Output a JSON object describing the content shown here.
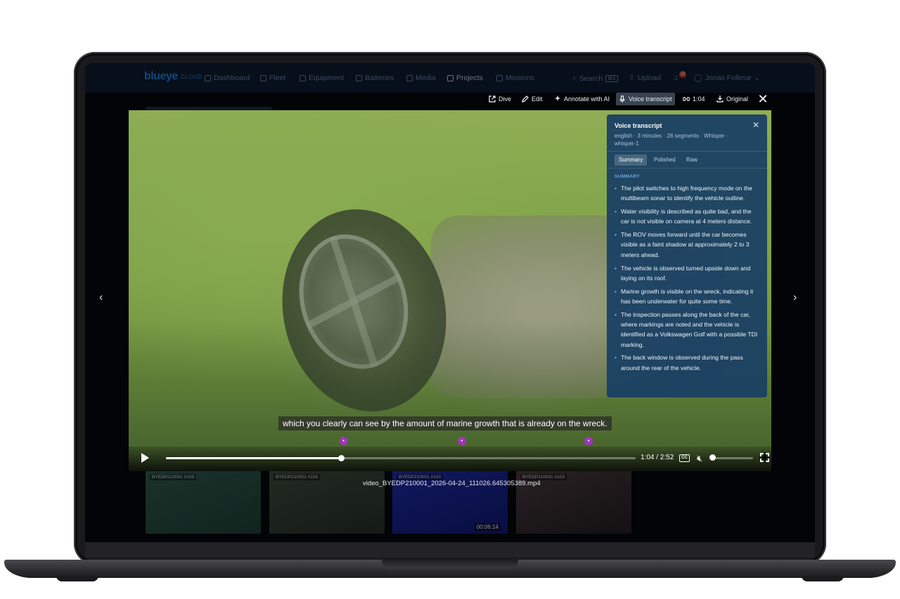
{
  "app": {
    "logo": "blueye",
    "logo_sub": "CLOUD",
    "nav": [
      {
        "label": "Dashboard",
        "icon": "grid-icon"
      },
      {
        "label": "Fleet",
        "icon": "fleet-icon"
      },
      {
        "label": "Equipment",
        "icon": "equipment-icon"
      },
      {
        "label": "Batteries",
        "icon": "battery-icon"
      },
      {
        "label": "Media",
        "icon": "media-icon"
      },
      {
        "label": "Projects",
        "icon": "projects-icon"
      },
      {
        "label": "Missions",
        "icon": "missions-icon"
      }
    ],
    "search_label": "Search",
    "search_shortcut": "⌘K",
    "upload_label": "Upload",
    "notification_count": "18",
    "user_name": "Jonas Follesø"
  },
  "toolbar": {
    "dive_label": "Dive",
    "edit_label": "Edit",
    "annotate_label": "Annotate with AI",
    "voice_label": "Voice transcript",
    "link_label": "1:04",
    "original_label": "Original"
  },
  "video": {
    "subtitle": "which you clearly can see by the amount of marine growth that is already on the wreck.",
    "current_time": "1:04",
    "duration": "2:52",
    "time_display": "1:04 / 2:52",
    "progress_fraction": 0.3721,
    "volume_fraction": 0,
    "cc_label": "CC",
    "muted": true,
    "markers": [
      0.378,
      0.63,
      0.9
    ]
  },
  "transcript": {
    "title": "Voice transcript",
    "meta": "english · 3 minutes · 28 segments · Whisper · whisper-1",
    "tabs": [
      "Summary",
      "Polished",
      "Raw"
    ],
    "active_tab": "Summary",
    "section_label": "SUMMARY",
    "summary": [
      "The pilot switches to high frequency mode on the multibeam sonar to identify the vehicle outline.",
      "Water visibility is described as quite bad, and the car is not visible on camera at 4 meters distance.",
      "The ROV moves forward until the car becomes visible as a faint shadow at approximately 2 to 3 meters ahead.",
      "The vehicle is observed turned upside down and laying on its roof.",
      "Marine growth is visible on the wreck, indicating it has been underwater for quite some time.",
      "The inspection passes along the back of the car, where markings are noted and the vehicle is identified as a Volkswagen Golf with a possible TDI marking.",
      "The back window is observed during the pass around the rear of the vehicle."
    ]
  },
  "thumbnails": [
    {
      "label": "BYEDP210001 #103",
      "duration": ""
    },
    {
      "label": "BYEDP210001 #103",
      "duration": ""
    },
    {
      "label": "BYEDP210001 #103",
      "duration": "00:06:14"
    },
    {
      "label": "BYEDP210001 #103",
      "duration": ""
    }
  ],
  "filename": "video_BYEDP210001_2026-04-24_111026.645305389.mp4",
  "colors": {
    "brand": "#2b7fd6",
    "panel": "#1a4064",
    "marker": "#a035b8"
  }
}
